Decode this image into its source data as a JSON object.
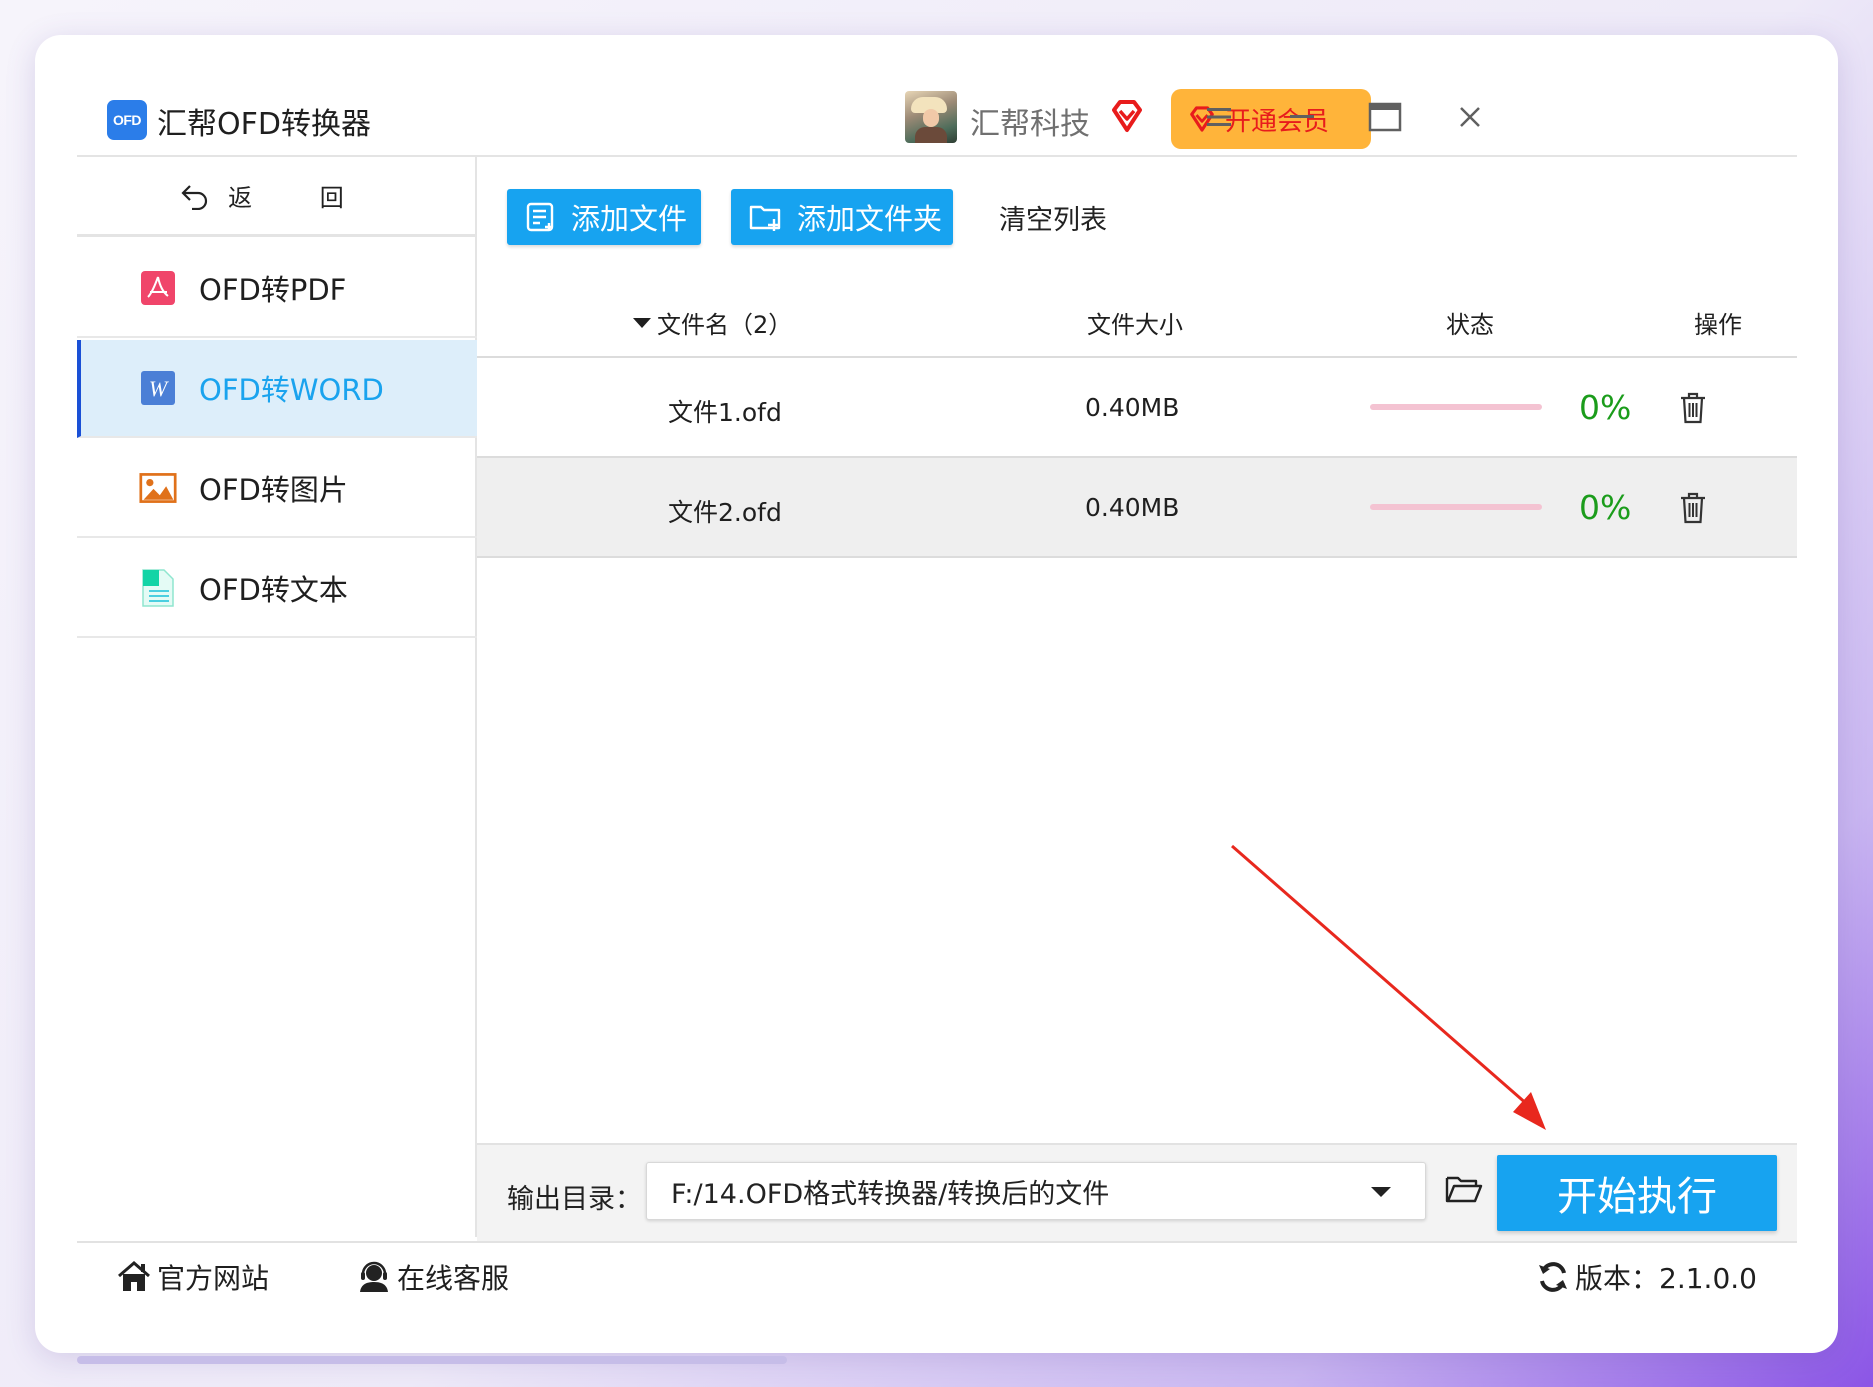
{
  "app": {
    "logo_text": "OFD",
    "title": "汇帮OFD转换器",
    "company": "汇帮科技",
    "vip_label": "开通会员"
  },
  "sidebar": {
    "back_label": "返 回",
    "items": [
      {
        "label": "OFD转PDF",
        "icon": "pdf-icon",
        "active": false
      },
      {
        "label": "OFD转WORD",
        "icon": "word-icon",
        "active": true
      },
      {
        "label": "OFD转图片",
        "icon": "image-icon",
        "active": false
      },
      {
        "label": "OFD转文本",
        "icon": "text-doc-icon",
        "active": false
      }
    ]
  },
  "toolbar": {
    "add_file": "添加文件",
    "add_folder": "添加文件夹",
    "clear_list": "清空列表"
  },
  "table": {
    "headers": {
      "name": "文件名（2）",
      "size": "文件大小",
      "status": "状态",
      "action": "操作"
    },
    "rows": [
      {
        "name": "文件1.ofd",
        "size": "0.40MB",
        "progress": 0,
        "percent": "0%"
      },
      {
        "name": "文件2.ofd",
        "size": "0.40MB",
        "progress": 0,
        "percent": "0%"
      }
    ]
  },
  "output": {
    "label": "输出目录：",
    "path": "F:/14.OFD格式转换器/转换后的文件",
    "start_label": "开始执行"
  },
  "footer": {
    "website": "官方网站",
    "support": "在线客服",
    "version_label": "版本：2.1.0.0"
  },
  "colors": {
    "accent": "#17a3f0",
    "vip_bg": "#ffb43a",
    "vip_text": "#e81c1c",
    "active_nav_bg": "#ddeefa",
    "percent_text": "#1b9c1b",
    "progress_track": "#f4c3d2",
    "annotation_arrow": "#e8281e"
  }
}
